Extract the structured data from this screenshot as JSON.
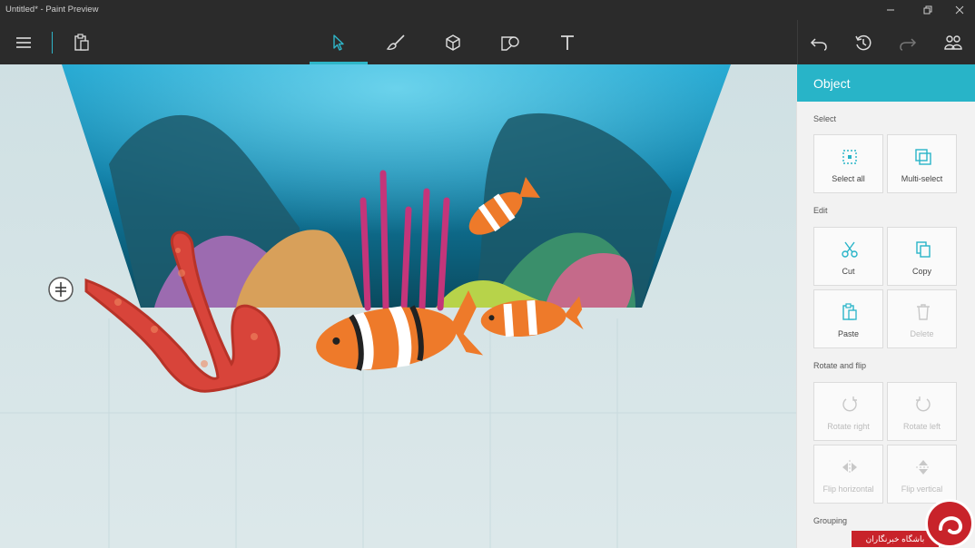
{
  "window": {
    "title": "Untitled* - Paint Preview"
  },
  "toolbar": {
    "tools": [
      {
        "name": "Select",
        "icon": "cursor-icon",
        "active": true
      },
      {
        "name": "Brushes",
        "icon": "brush-icon"
      },
      {
        "name": "3D objects",
        "icon": "cube-icon"
      },
      {
        "name": "Stickers",
        "icon": "sticker-icon"
      },
      {
        "name": "Text",
        "icon": "text-icon"
      }
    ],
    "right": [
      "undo-icon",
      "history-icon",
      "redo-icon",
      "community-icon"
    ]
  },
  "panel": {
    "title": "Object",
    "select_label": "Select",
    "select_all": "Select all",
    "multi_select": "Multi-select",
    "edit_label": "Edit",
    "cut": "Cut",
    "copy": "Copy",
    "paste": "Paste",
    "delete": "Delete",
    "rotate_label": "Rotate and flip",
    "rotate_right": "Rotate right",
    "rotate_left": "Rotate left",
    "flip_horizontal": "Flip horizontal",
    "flip_vertical": "Flip vertical",
    "grouping_label": "Grouping"
  },
  "colors": {
    "accent": "#28b4c8",
    "chrome": "#2b2b2b",
    "coral": "#d8443a",
    "fish": "#ee7a2a"
  },
  "watermark": {
    "text": "باشگاه خبرنگاران"
  }
}
